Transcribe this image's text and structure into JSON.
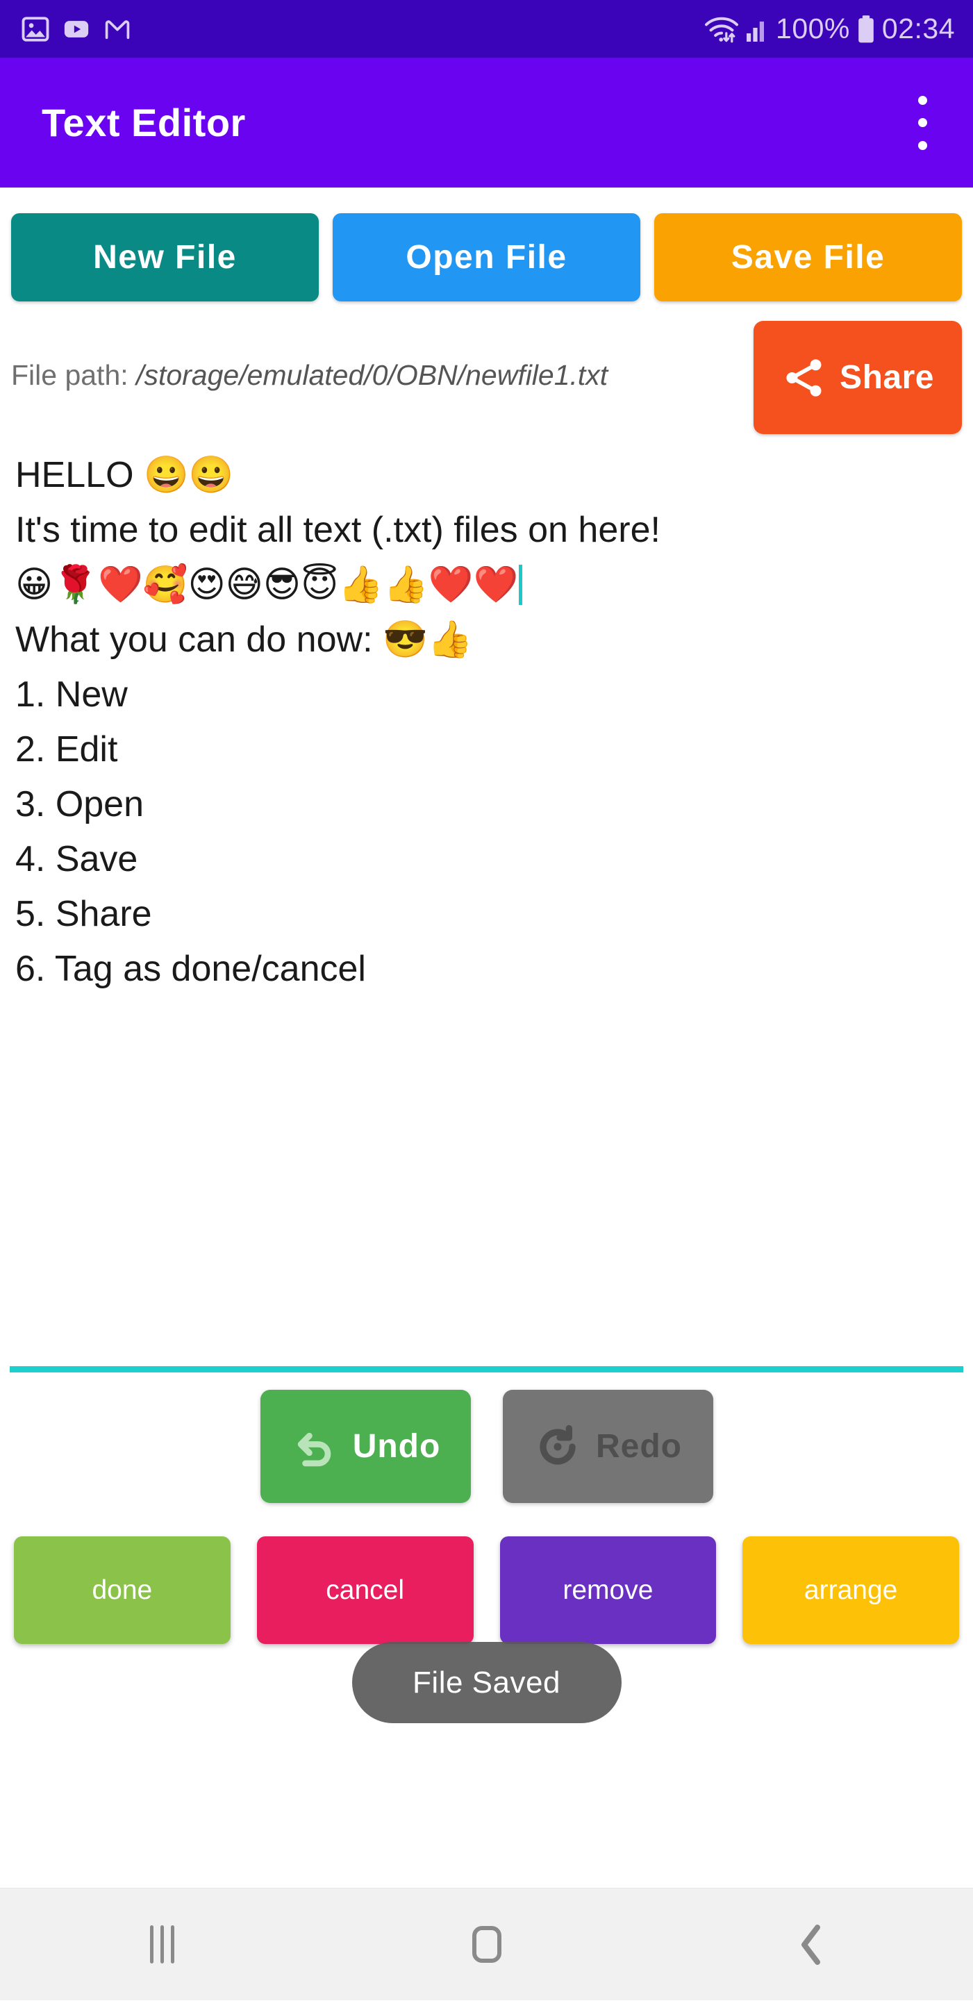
{
  "status_bar": {
    "background": "#3b04b8",
    "notification_icons": [
      "gallery-image-icon",
      "youtube-icon",
      "gmail-icon"
    ],
    "wifi_icon": "wifi-data-transfer-icon",
    "signal_icon": "cellular-signal-icon",
    "battery_percent": "100%",
    "battery_icon": "battery-full-icon",
    "time": "02:34"
  },
  "app_bar": {
    "title": "Text Editor",
    "background": "#6a03f0",
    "overflow_icon": "overflow-menu-icon"
  },
  "file_actions": [
    {
      "label": "New File",
      "color": "#0a8a85"
    },
    {
      "label": "Open File",
      "color": "#2196f3"
    },
    {
      "label": "Save File",
      "color": "#f9a202"
    }
  ],
  "file_path": {
    "label": "File path:",
    "value": "/storage/emulated/0/OBN/newfile1.txt"
  },
  "share": {
    "label": "Share",
    "color": "#f4511e",
    "icon": "share-icon"
  },
  "editor": {
    "lines": [
      "HELLO 😀😀",
      "",
      "It's time to edit all text (.txt) files on here!",
      "😀🌹❤️🥰😍😅😎😇👍👍❤️❤️",
      "",
      "What you can do now: 😎👍",
      "1. New",
      "2. Edit",
      "3. Open",
      "4. Save",
      "5. Share",
      "6. Tag as done/cancel"
    ],
    "caret_after_line_index": 3,
    "caret_color": "#1ec8c8",
    "divider_color": "#1ed0cd"
  },
  "history": {
    "undo": {
      "label": "Undo",
      "color": "#4caf50",
      "icon": "undo-arrow-icon",
      "enabled": true
    },
    "redo": {
      "label": "Redo",
      "color": "#757575",
      "icon": "redo-arrow-icon",
      "enabled": false
    }
  },
  "tags": [
    {
      "label": "done",
      "color": "#8bc34a"
    },
    {
      "label": "cancel",
      "color": "#e91e5f"
    },
    {
      "label": "remove",
      "color": "#6a30c2"
    },
    {
      "label": "arrange",
      "color": "#fdc107"
    }
  ],
  "toast": {
    "message": "File Saved",
    "background": "#5a5a5a"
  },
  "nav_bar": {
    "items": [
      "recents-icon",
      "home-icon",
      "back-icon"
    ],
    "background": "#f1f1f1"
  }
}
